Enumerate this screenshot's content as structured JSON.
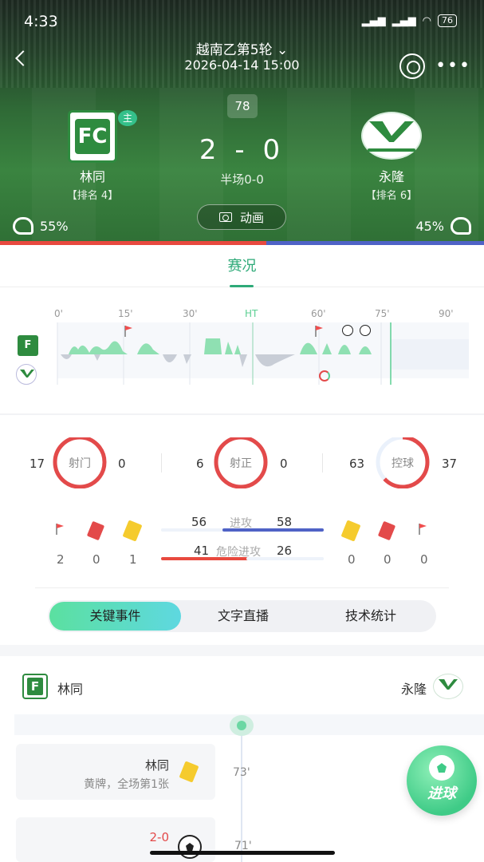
{
  "status_bar": {
    "time": "4:33",
    "battery": "76"
  },
  "header": {
    "round": "越南乙第5轮",
    "datetime": "2026-04-14 15:00",
    "minute": "78",
    "score": "2 - 0",
    "half_time": "半场0-0",
    "animation_label": "动画",
    "home": {
      "name": "林同",
      "rank": "【排名 4】",
      "badge": "主",
      "strength": "55%"
    },
    "away": {
      "name": "永隆",
      "rank": "【排名 6】",
      "strength": "45%"
    }
  },
  "main_tab": "赛况",
  "timeline": {
    "ticks": [
      "0'",
      "15'",
      "30'",
      "HT",
      "60'",
      "75'",
      "90'"
    ],
    "current_minute": 78
  },
  "stats_circles": [
    {
      "label": "射门",
      "home": "17",
      "away": "0",
      "home_share": 1.0
    },
    {
      "label": "射正",
      "home": "6",
      "away": "0",
      "home_share": 1.0
    },
    {
      "label": "控球",
      "home": "63",
      "away": "37",
      "home_share": 0.63
    }
  ],
  "bar_stats": [
    {
      "label": "进攻",
      "home": "56",
      "away": "58"
    },
    {
      "label": "危险进攻",
      "home": "41",
      "away": "26"
    }
  ],
  "card_counts": {
    "home": {
      "corners": "2",
      "red": "0",
      "yellow": "1"
    },
    "away": {
      "yellow": "0",
      "red": "0",
      "corners": "0"
    }
  },
  "sub_tabs": [
    "关键事件",
    "文字直播",
    "技术统计"
  ],
  "events": {
    "home_name": "林同",
    "away_name": "永隆",
    "items": [
      {
        "minute": "73'",
        "team": "林同",
        "desc": "黄牌，全场第1张",
        "type": "yellow-card"
      },
      {
        "minute": "71'",
        "score": "2-0",
        "type": "goal"
      }
    ]
  },
  "fab": {
    "label": "进球"
  },
  "colors": {
    "accent": "#2eaa78",
    "home_bar": "#e8493f",
    "away_bar": "#4f62c6"
  }
}
